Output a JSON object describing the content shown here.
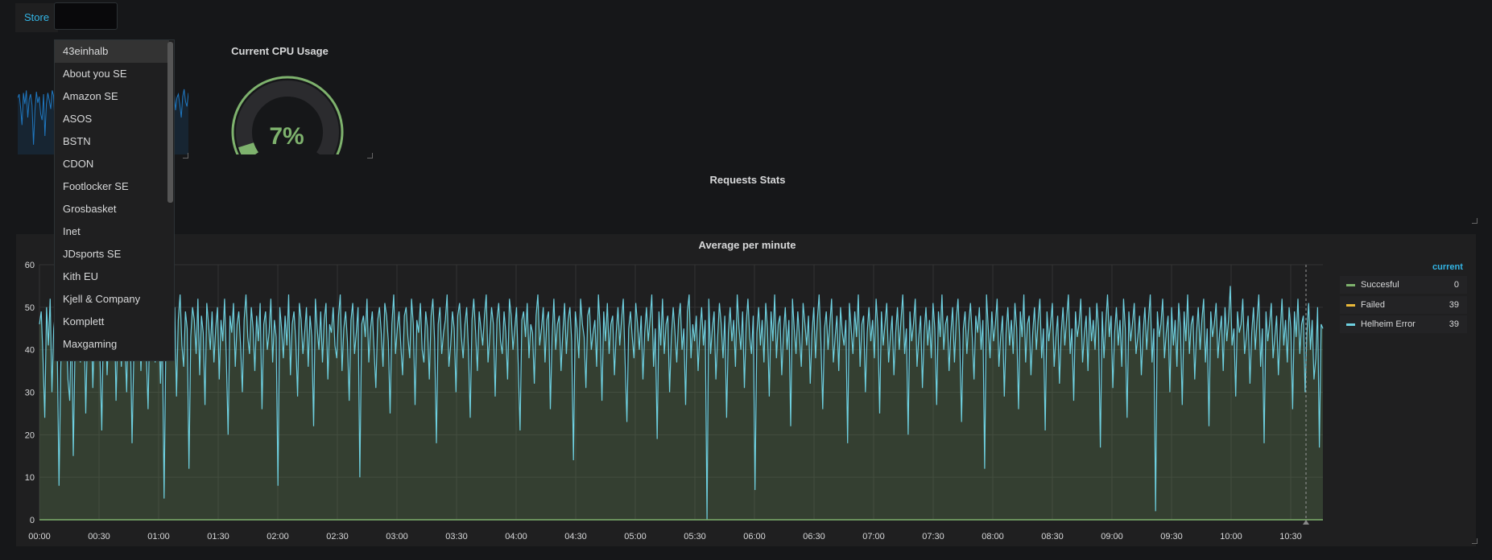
{
  "variable": {
    "label": "Store",
    "value": ""
  },
  "dropdown": {
    "items": [
      "43einhalb",
      "About you SE",
      "Amazon SE",
      "ASOS",
      "BSTN",
      "CDON",
      "Footlocker SE",
      "Grosbasket",
      "Inet",
      "JDsports SE",
      "Kith EU",
      "Kjell & Company",
      "Komplett",
      "Maxgaming"
    ],
    "selected_index": 0
  },
  "cpu_panel": {
    "title": "Current CPU Usage",
    "value": "7%",
    "percent": 7,
    "color": "#7eb26d"
  },
  "requests_panel": {
    "title": "Requests Stats"
  },
  "chart_data": {
    "type": "line",
    "title": "Average per minute",
    "x_ticks": [
      "00:00",
      "00:30",
      "01:00",
      "01:30",
      "02:00",
      "02:30",
      "03:00",
      "03:30",
      "04:00",
      "04:30",
      "05:00",
      "05:30",
      "06:00",
      "06:30",
      "07:00",
      "07:30",
      "08:00",
      "08:30",
      "09:00",
      "09:30",
      "10:00",
      "10:30"
    ],
    "y_ticks": [
      "0",
      "10",
      "20",
      "30",
      "40",
      "50",
      "60"
    ],
    "ylim": [
      0,
      60
    ],
    "grid": true,
    "legend_position": "right",
    "legend_header": "current",
    "series": [
      {
        "name": "Succesful",
        "color": "#7eb26d",
        "current": "0",
        "values": [
          0
        ]
      },
      {
        "name": "Failed",
        "color": "#eab839",
        "current": "39",
        "values": []
      },
      {
        "name": "Helheim Error",
        "color": "#6ed0e0",
        "current": "39",
        "values": [
          46,
          49,
          38,
          24,
          50,
          41,
          52,
          30,
          45,
          49,
          40,
          8,
          36,
          51,
          42,
          47,
          33,
          28,
          49,
          15,
          41,
          50,
          44,
          37,
          52,
          48,
          25,
          45,
          39,
          49,
          31,
          46,
          43,
          53,
          38,
          21,
          49,
          50,
          34,
          45,
          47,
          41,
          52,
          28,
          44,
          50,
          36,
          48,
          42,
          30,
          51,
          46,
          18,
          39,
          49,
          44,
          53,
          35,
          47,
          50,
          40,
          26,
          48,
          43,
          51,
          37,
          45,
          49,
          32,
          46,
          5,
          42,
          51,
          48,
          38,
          44,
          50,
          29,
          47,
          53,
          41,
          36,
          49,
          45,
          12,
          43,
          50,
          47,
          39,
          52,
          34,
          48,
          44,
          27,
          51,
          46,
          40,
          49,
          37,
          45,
          50,
          33,
          47,
          42,
          52,
          38,
          20,
          48,
          44,
          51,
          36,
          46,
          49,
          41,
          30,
          47,
          53,
          43,
          39,
          50,
          45,
          35,
          48,
          42,
          51,
          26,
          46,
          49,
          40,
          44,
          52,
          37,
          47,
          43,
          8,
          50,
          45,
          38,
          48,
          41,
          53,
          34,
          46,
          49,
          42,
          29,
          51,
          47,
          39,
          44,
          50,
          36,
          48,
          43,
          22,
          52,
          45,
          40,
          49,
          37,
          47,
          51,
          33,
          46,
          44,
          50,
          41,
          38,
          48,
          53,
          35,
          45,
          49,
          42,
          28,
          47,
          51,
          39,
          44,
          50,
          10,
          46,
          48,
          43,
          52,
          37,
          45,
          49,
          40,
          31,
          47,
          50,
          44,
          36,
          51,
          48,
          42,
          25,
          46,
          53,
          39,
          45,
          49,
          41,
          34,
          48,
          50,
          43,
          38,
          52,
          46,
          27,
          47,
          44,
          51,
          40,
          37,
          49,
          45,
          33,
          48,
          52,
          42,
          18,
          46,
          50,
          39,
          44,
          47,
          53,
          36,
          41,
          49,
          45,
          30,
          48,
          51,
          43,
          38,
          46,
          50,
          40,
          24,
          47,
          52,
          44,
          35,
          49,
          45,
          41,
          48,
          53,
          37,
          43,
          50,
          46,
          29,
          47,
          51,
          42,
          39,
          49,
          44,
          33,
          52,
          48,
          40,
          45,
          50,
          36,
          21,
          47,
          49,
          43,
          51,
          38,
          46,
          44,
          32,
          48,
          53,
          41,
          45,
          50,
          37,
          47,
          49,
          26,
          43,
          52,
          40,
          46,
          48,
          35,
          44,
          51,
          39,
          47,
          50,
          42,
          14,
          49,
          45,
          38,
          52,
          46,
          43,
          31,
          48,
          50,
          40,
          44,
          47,
          36,
          53,
          45,
          28,
          49,
          42,
          51,
          39,
          46,
          48,
          34,
          44,
          50,
          41,
          47,
          52,
          37,
          23,
          45,
          49,
          43,
          38,
          51,
          46,
          40,
          48,
          33,
          44,
          50,
          42,
          47,
          53,
          36,
          45,
          19,
          49,
          41,
          52,
          39,
          46,
          48,
          30,
          43,
          50,
          44,
          37,
          47,
          51,
          40,
          45,
          27,
          49,
          53,
          38,
          46,
          42,
          48,
          35,
          44,
          50,
          41,
          47,
          0,
          52,
          39,
          45,
          49,
          33,
          43,
          51,
          46,
          38,
          48,
          24,
          44,
          50,
          42,
          47,
          36,
          53,
          45,
          40,
          49,
          31,
          46,
          52,
          43,
          39,
          48,
          7,
          44,
          50,
          41,
          47,
          37,
          51,
          45,
          29,
          49,
          42,
          53,
          38,
          46,
          48,
          34,
          44,
          50,
          40,
          47,
          22,
          52,
          45,
          39,
          49,
          43,
          36,
          51,
          46,
          41,
          48,
          32,
          44,
          50,
          38,
          47,
          53,
          42,
          26,
          45,
          49,
          40,
          46,
          52,
          37,
          43,
          48,
          35,
          50,
          44,
          41,
          47,
          18,
          51,
          45,
          39,
          49,
          43,
          53,
          36,
          46,
          48,
          30,
          44,
          50,
          42,
          47,
          38,
          52,
          45,
          25,
          49,
          41,
          46,
          51,
          37,
          43,
          48,
          34,
          44,
          50,
          40,
          47,
          53,
          39,
          45,
          20,
          49,
          42,
          46,
          52,
          36,
          43,
          48,
          31,
          44,
          50,
          41,
          47,
          38,
          51,
          45,
          27,
          49,
          43,
          53,
          40,
          46,
          48,
          35,
          44,
          50,
          37,
          47,
          52,
          42,
          23,
          45,
          49,
          39,
          46,
          51,
          43,
          33,
          48,
          44,
          50,
          40,
          47,
          12,
          53,
          45,
          38,
          49,
          42,
          46,
          52,
          36,
          43,
          48,
          29,
          44,
          50,
          41,
          47,
          39,
          51,
          45,
          26,
          49,
          43,
          53,
          37,
          46,
          48,
          34,
          44,
          50,
          40,
          47,
          52,
          38,
          45,
          21,
          49,
          42,
          46,
          51,
          36,
          43,
          48,
          32,
          44,
          50,
          41,
          47,
          53,
          39,
          45,
          28,
          49,
          43,
          46,
          52,
          37,
          44,
          48,
          35,
          50,
          42,
          47,
          40,
          51,
          45,
          17,
          49,
          38,
          46,
          53,
          43,
          48,
          31,
          44,
          50,
          41,
          47,
          36,
          52,
          45,
          24,
          49,
          42,
          46,
          51,
          39,
          43,
          48,
          34,
          44,
          50,
          40,
          47,
          53,
          37,
          45,
          2,
          49,
          43,
          46,
          52,
          38,
          44,
          48,
          30,
          50,
          41,
          47,
          36,
          51,
          45,
          27,
          49,
          42,
          53,
          39,
          46,
          48,
          33,
          44,
          50,
          40,
          47,
          52,
          37,
          45,
          22,
          49,
          43,
          46,
          51,
          38,
          44,
          48,
          35,
          50,
          42,
          47,
          55,
          41,
          45,
          29,
          49,
          44,
          46,
          52,
          39,
          43,
          48,
          32,
          44,
          50,
          40,
          47,
          53,
          36,
          45,
          18,
          49,
          42,
          46,
          51,
          38,
          43,
          48,
          34,
          44,
          52,
          41,
          47,
          37,
          50,
          45,
          26,
          49,
          43,
          52,
          39,
          46,
          48,
          30,
          44,
          51,
          40,
          47,
          33,
          38,
          50,
          17,
          46,
          45
        ]
      }
    ]
  }
}
